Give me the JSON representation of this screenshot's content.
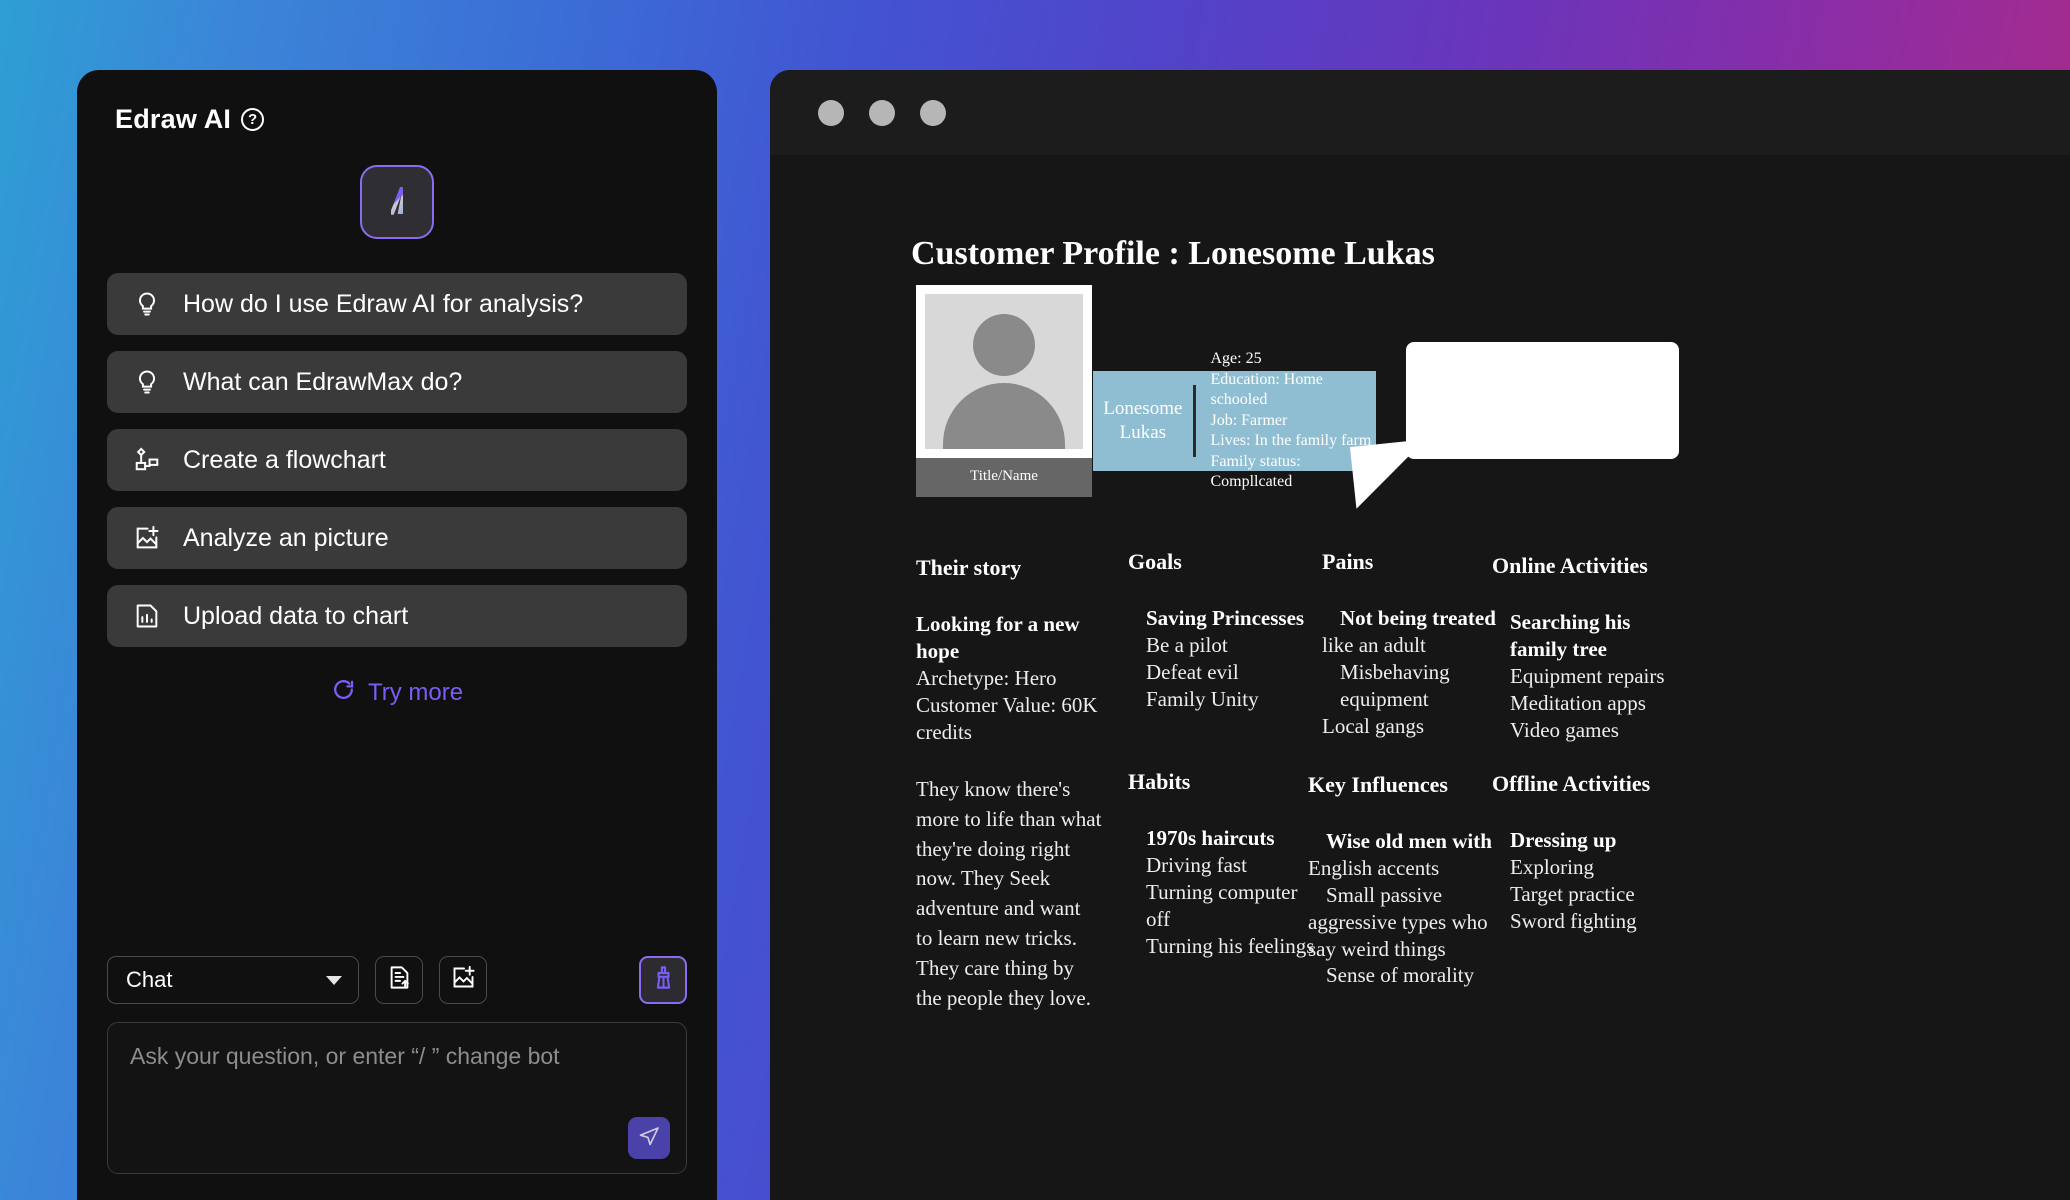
{
  "sidebar": {
    "title": "Edraw AI",
    "help_icon": "question-circle-icon",
    "logo_glyph": "/I",
    "suggestions": [
      {
        "label": "How do I use Edraw AI for analysis?",
        "icon": "lightbulb-icon"
      },
      {
        "label": "What can EdrawMax do?",
        "icon": "lightbulb-icon"
      },
      {
        "label": "Create a flowchart",
        "icon": "flowchart-icon"
      },
      {
        "label": "Analyze an picture",
        "icon": "image-add-icon"
      },
      {
        "label": "Upload data to chart",
        "icon": "chart-file-icon"
      }
    ],
    "try_more": {
      "label": "Try more",
      "icon": "refresh-icon"
    },
    "toolbar": {
      "mode_value": "Chat",
      "chevron_icon": "chevron-down-icon",
      "file_upload_icon": "file-upload-icon",
      "image_upload_icon": "image-add-icon",
      "clear_icon": "broom-icon"
    },
    "composer": {
      "placeholder": "Ask your question, or enter  “/  ” change bot",
      "send_icon": "send-icon"
    }
  },
  "window": {
    "dots": [
      "close-dot",
      "minimize-dot",
      "maximize-dot"
    ]
  },
  "document": {
    "title": "Customer Profile : Lonesome Lukas",
    "avatar": {
      "caption": "Title/Name",
      "icon": "person-placeholder-icon"
    },
    "info_card": {
      "name": "Lonesome\nLukas",
      "lines": [
        "Age: 25",
        "Education: Home schooled",
        "Job: Farmer",
        "Lives: In the family farm",
        "Family status: Compllcated"
      ]
    },
    "speech_bubble": {
      "text": ""
    },
    "columns": [
      {
        "heading": "Their story",
        "lead": "Looking for a new hope",
        "lines": [
          "Archetype: Hero",
          "Customer Value: 60K credits"
        ]
      },
      {
        "heading": "Goals",
        "lead": "Saving Princesses",
        "lines": [
          "Be a pilot",
          "Defeat evil",
          "Family Unity"
        ]
      },
      {
        "heading": "Pains",
        "lead": "Not being treated",
        "lines": [
          "like an adult",
          "Misbehaving",
          "equipment",
          "Local gangs"
        ]
      },
      {
        "heading": "Online Activities",
        "lead": "Searching his family tree",
        "lines": [
          "Equipment repairs",
          "Meditation apps",
          "Video games"
        ]
      }
    ],
    "story_paragraph": "They know there's more to life than what they're doing right now. They Seek adventure and want to learn new tricks. They care thing by the people they love.",
    "columns_bottom": [
      {
        "heading": "Habits",
        "lead": "1970s haircuts",
        "lines": [
          "Driving fast",
          "Turning computer off",
          "Turning his feelings"
        ]
      },
      {
        "heading": "Key Influences",
        "lead": "Wise old men with",
        "lines": [
          "English accents",
          "Small passive",
          "aggressive types who",
          "say weird things",
          "Sense of morality"
        ]
      },
      {
        "heading": "Offline Activities",
        "lead": "Dressing up",
        "lines": [
          "Exploring",
          "Target practice",
          "Sword fighting"
        ]
      }
    ]
  },
  "colors": {
    "accent_purple": "#7b5cf5",
    "info_card_blue": "#8fbed2",
    "panel_bg": "#101010"
  }
}
